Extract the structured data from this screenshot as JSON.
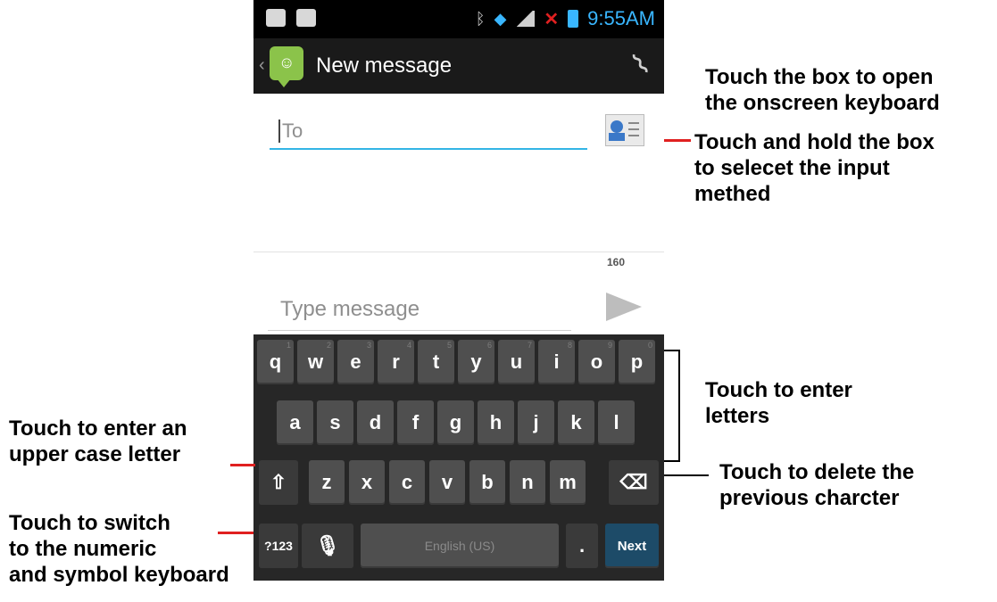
{
  "status_bar": {
    "time": "9:55AM"
  },
  "action_bar": {
    "title": "New message"
  },
  "compose": {
    "to_placeholder": "To",
    "char_counter": "160",
    "message_placeholder": "Type message"
  },
  "keyboard": {
    "row1": [
      "q",
      "w",
      "e",
      "r",
      "t",
      "y",
      "u",
      "i",
      "o",
      "p"
    ],
    "row1_hints": [
      "1",
      "2",
      "3",
      "4",
      "5",
      "6",
      "7",
      "8",
      "9",
      "0"
    ],
    "row2": [
      "a",
      "s",
      "d",
      "f",
      "g",
      "h",
      "j",
      "k",
      "l"
    ],
    "row3": [
      "z",
      "x",
      "c",
      "v",
      "b",
      "n",
      "m"
    ],
    "symbols_label": "?123",
    "space_label": "English (US)",
    "period_label": ".",
    "next_label": "Next"
  },
  "annotations": {
    "open_keyboard": "Touch the box to open\nthe onscreen keyboard",
    "select_input": "Touch and hold the box\nto selecet the input\nmethed",
    "enter_letters": "Touch to enter\nletters",
    "upper_case": "Touch to enter an\nupper case letter",
    "delete_char": "Touch to delete the\nprevious charcter",
    "switch_numeric": "Touch to switch\nto the numeric\nand symbol keyboard"
  }
}
